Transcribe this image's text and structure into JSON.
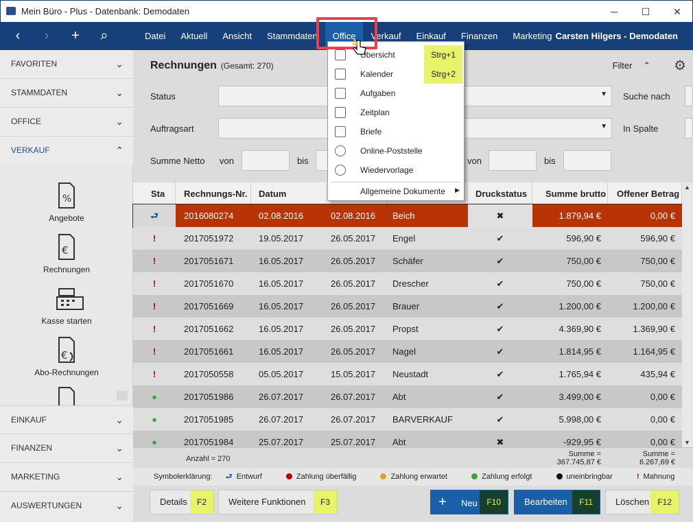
{
  "window": {
    "title": "Mein Büro - Plus - Datenbank: Demodaten",
    "min": "─",
    "max": "☐",
    "close": "✕"
  },
  "nav": {
    "back": "‹",
    "forward": "›",
    "add": "+",
    "search": "⌕"
  },
  "menu": [
    "Datei",
    "Aktuell",
    "Ansicht",
    "Stammdaten",
    "Office",
    "Verkauf",
    "Einkauf",
    "Finanzen",
    "Marketing"
  ],
  "user": "Carsten Hilgers - Demodaten",
  "sidebar": {
    "sections_top": [
      "FAVORITEN",
      "STAMMDATEN",
      "OFFICE",
      "VERKAUF"
    ],
    "sections_bottom": [
      "EINKAUF",
      "FINANZEN",
      "MARKETING",
      "AUSWERTUNGEN"
    ],
    "items": [
      "Angebote",
      "Rechnungen",
      "Kasse starten",
      "Abo-Rechnungen"
    ]
  },
  "page": {
    "title": "Rechnungen",
    "total": "(Gesamt: 270)",
    "filter": "Filter"
  },
  "filters": {
    "status": "Status",
    "auftragsart": "Auftragsart",
    "summe_netto": "Summe Netto",
    "von": "von",
    "bis": "bis",
    "suche_nach": "Suche nach",
    "in_spalte": "In Spalte"
  },
  "columns": [
    "Sta",
    "Rechnungs-Nr.",
    "Datum",
    "",
    "",
    "Druckstatus",
    "Summe brutto",
    "Offener Betrag"
  ],
  "rows": [
    {
      "icon": "⮐",
      "nr": "2016080274",
      "datum": "02.08.2016",
      "faellig": "02.08.2016",
      "kunde": "Beich",
      "druck": "✖",
      "brutto": "1.879,94 €",
      "offen": "0,00 €"
    },
    {
      "icon": "!",
      "nr": "2017051972",
      "datum": "19.05.2017",
      "faellig": "26.05.2017",
      "kunde": "Engel",
      "druck": "✔",
      "brutto": "596,90 €",
      "offen": "596,90 €"
    },
    {
      "icon": "!",
      "nr": "2017051671",
      "datum": "16.05.2017",
      "faellig": "26.05.2017",
      "kunde": "Schäfer",
      "druck": "✔",
      "brutto": "750,00 €",
      "offen": "750,00 €"
    },
    {
      "icon": "!",
      "nr": "2017051670",
      "datum": "16.05.2017",
      "faellig": "26.05.2017",
      "kunde": "Drescher",
      "druck": "✔",
      "brutto": "750,00 €",
      "offen": "750,00 €"
    },
    {
      "icon": "!",
      "nr": "2017051669",
      "datum": "16.05.2017",
      "faellig": "26.05.2017",
      "kunde": "Brauer",
      "druck": "✔",
      "brutto": "1.200,00 €",
      "offen": "1.200,00 €"
    },
    {
      "icon": "!",
      "nr": "2017051662",
      "datum": "16.05.2017",
      "faellig": "26.05.2017",
      "kunde": "Propst",
      "druck": "✔",
      "brutto": "4.369,90 €",
      "offen": "1.369,90 €"
    },
    {
      "icon": "!",
      "nr": "2017051661",
      "datum": "16.05.2017",
      "faellig": "26.05.2017",
      "kunde": "Nagel",
      "druck": "✔",
      "brutto": "1.814,95 €",
      "offen": "1.164,95 €"
    },
    {
      "icon": "!",
      "nr": "2017050558",
      "datum": "05.05.2017",
      "faellig": "15.05.2017",
      "kunde": "Neustadt",
      "druck": "✔",
      "brutto": "1.765,94 €",
      "offen": "435,94 €"
    },
    {
      "icon": "●",
      "nr": "2017051986",
      "datum": "26.07.2017",
      "faellig": "26.07.2017",
      "kunde": "Abt",
      "druck": "✔",
      "brutto": "3.499,00 €",
      "offen": "0,00 €"
    },
    {
      "icon": "●",
      "nr": "2017051985",
      "datum": "26.07.2017",
      "faellig": "26.07.2017",
      "kunde": "BARVERKAUF",
      "druck": "✔",
      "brutto": "5.998,00 €",
      "offen": "0,00 €"
    },
    {
      "icon": "●",
      "nr": "2017051984",
      "datum": "25.07.2017",
      "faellig": "25.07.2017",
      "kunde": "Abt",
      "druck": "✖",
      "brutto": "-929,95 €",
      "offen": "0,00 €"
    }
  ],
  "footer": {
    "anzahl": "Anzahl = 270",
    "summe_label1": "Summe =",
    "summe1": "367.745,87 €",
    "summe_label2": "Summe =",
    "summe2": "6.267,69 €"
  },
  "legend": {
    "title": "Symbolerklärung:",
    "items": [
      "Entwurf",
      "Zahlung überfällig",
      "Zahlung erwartet",
      "Zahlung erfolgt",
      "uneinbringbar",
      "Mahnung fällig"
    ],
    "colors": [
      "#1b4f95",
      "#b00000",
      "#e0a020",
      "#3aa63a",
      "#111111",
      "#b00000"
    ]
  },
  "buttons": {
    "details": "Details",
    "details_key": "F2",
    "weitere": "Weitere Funktionen",
    "weitere_key": "F3",
    "neu": "Neu",
    "neu_key": "F10",
    "bearbeiten": "Bearbeiten",
    "bearbeiten_key": "F11",
    "loeschen": "Löschen",
    "loeschen_key": "F12"
  },
  "dropdown": {
    "items": [
      {
        "label": "Übersicht",
        "key": "Strg+1"
      },
      {
        "label": "Kalender",
        "key": "Strg+2"
      },
      {
        "label": "Aufgaben",
        "key": ""
      },
      {
        "label": "Zeitplan",
        "key": ""
      },
      {
        "label": "Briefe",
        "key": ""
      },
      {
        "label": "Online-Poststelle",
        "key": ""
      },
      {
        "label": "Wiedervorlage",
        "key": ""
      },
      {
        "label": "Allgemeine Dokumente",
        "key": ""
      }
    ]
  },
  "colors": {
    "nav": "#173f7a",
    "accent": "#1b5fa8",
    "selected_row": "#b83406",
    "hotkey": "#e9f36a",
    "highlight_box": "#ee3d4d"
  }
}
